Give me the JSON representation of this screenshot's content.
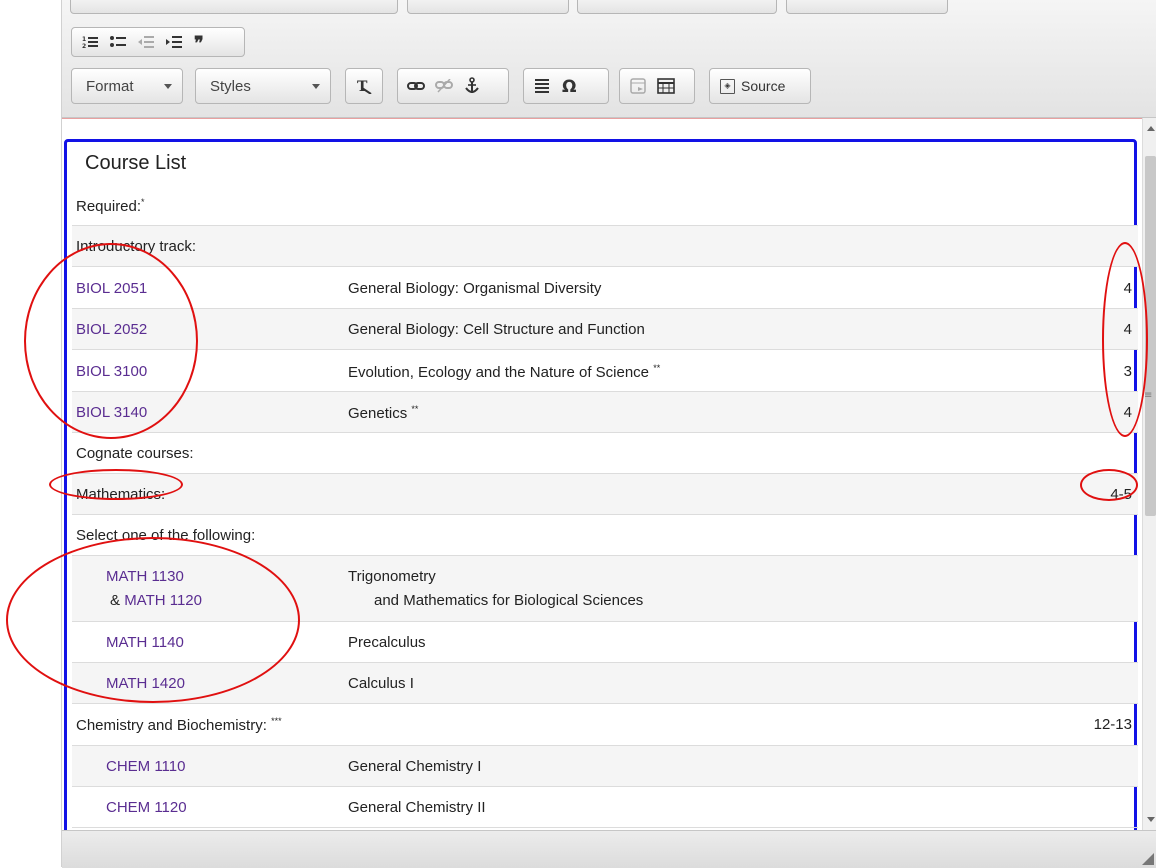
{
  "toolbar": {
    "format_label": "Format",
    "styles_label": "Styles",
    "source_label": "Source"
  },
  "content": {
    "legend": "Course List",
    "rows": [
      {
        "c1": "Required:",
        "sup": "*"
      },
      {
        "c1": "Introductory track:"
      },
      {
        "c1": "BIOL 2051",
        "c2": "General Biology: Organismal Diversity",
        "c3": "4"
      },
      {
        "c1": "BIOL 2052",
        "c2": "General Biology: Cell Structure and Function",
        "c3": "4"
      },
      {
        "c1": "BIOL 3100",
        "c2": "Evolution, Ecology and the Nature of Science",
        "c2sup": "**",
        "c3": "3"
      },
      {
        "c1": "BIOL 3140",
        "c2": "Genetics",
        "c2sup": "**",
        "c3": "4"
      },
      {
        "c1": "Cognate courses:"
      },
      {
        "c1": "Mathematics:",
        "c3": "4-5"
      },
      {
        "c1": "Select one of the following:"
      },
      {
        "c1": "MATH 1130",
        "c1b_prefix": "& ",
        "c1b": "MATH 1120",
        "c2": "Trigonometry",
        "c2b": "and Mathematics for Biological Sciences"
      },
      {
        "c1": "MATH 1140",
        "c2": "Precalculus"
      },
      {
        "c1": "MATH 1420",
        "c2": "Calculus I"
      },
      {
        "c1": "Chemistry and Biochemistry:",
        "sup": "***",
        "c3": "12-13"
      },
      {
        "c1": "CHEM 1110",
        "c2": "General Chemistry I"
      },
      {
        "c1": "CHEM 1120",
        "c2": "General Chemistry II"
      }
    ]
  },
  "icons": {
    "numbered_list": "numbered-list-icon",
    "bulleted_list": "bulleted-list-icon",
    "outdent": "outdent-icon",
    "indent": "indent-icon",
    "blockquote": "blockquote-icon",
    "remove_format": "remove-format-icon",
    "link": "link-icon",
    "unlink": "unlink-icon",
    "anchor": "anchor-icon",
    "horizontal_line": "horizontal-line-icon",
    "special_char": "omega-icon",
    "iframe": "iframe-icon",
    "table": "table-icon",
    "source": "source-icon"
  },
  "colors": {
    "fieldset_border": "#1212e6",
    "link": "#5a2d91",
    "annotation": "#e01010"
  }
}
